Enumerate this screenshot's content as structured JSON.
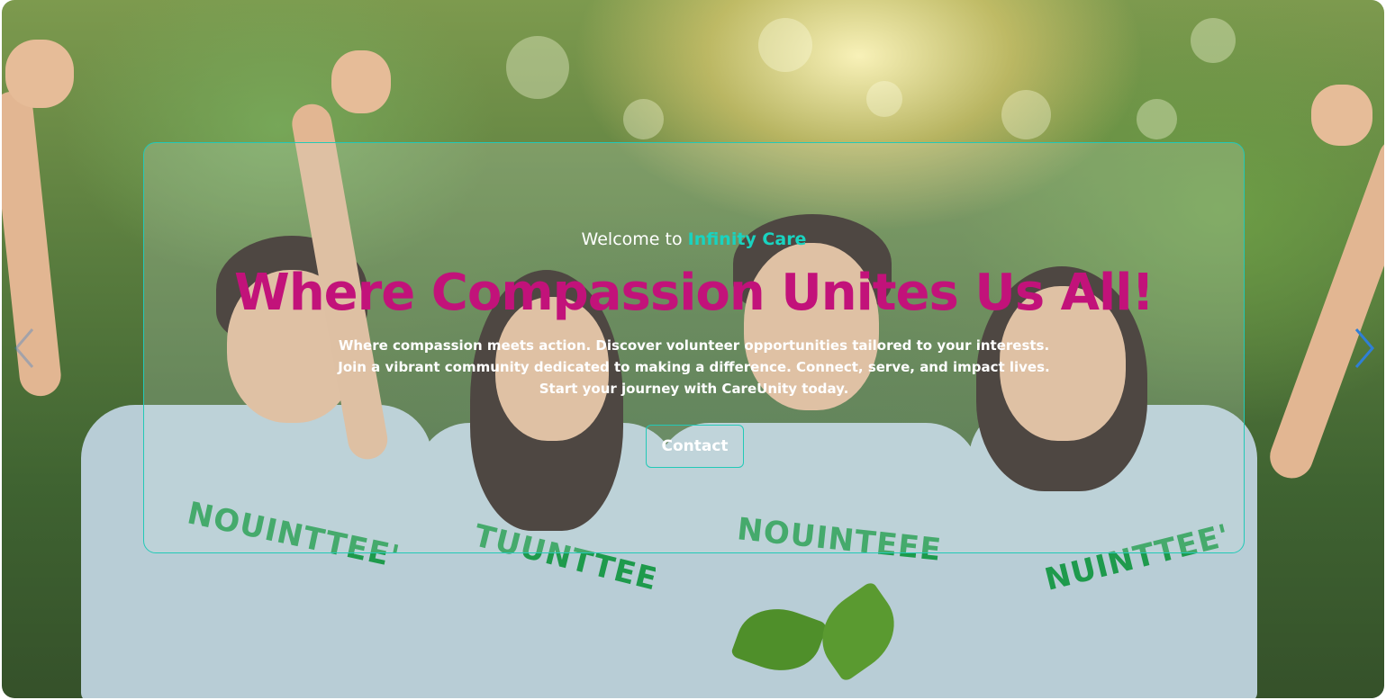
{
  "hero": {
    "welcome_prefix": "Welcome to",
    "brand_name": "Infinity Care",
    "headline": "Where Compassion Unites Us All!",
    "description": "Where compassion meets action. Discover volunteer opportunities tailored to your interests. Join a vibrant community dedicated to making a difference. Connect, serve, and impact lives. Start your journey with CareUnity today.",
    "contact_label": "Contact",
    "shirt_texts": [
      "NOUINTTEE'",
      "TUUNTTEE",
      "NOUINTEEE",
      "NUINTTEE'"
    ]
  },
  "carousel": {
    "prev_icon": "chevron-left-icon",
    "next_icon": "chevron-right-icon"
  },
  "colors": {
    "accent_teal": "#19d3c0",
    "headline_magenta": "#c2127a",
    "border_teal": "#23c9b7",
    "arrow_blue": "#2f7fd6"
  }
}
